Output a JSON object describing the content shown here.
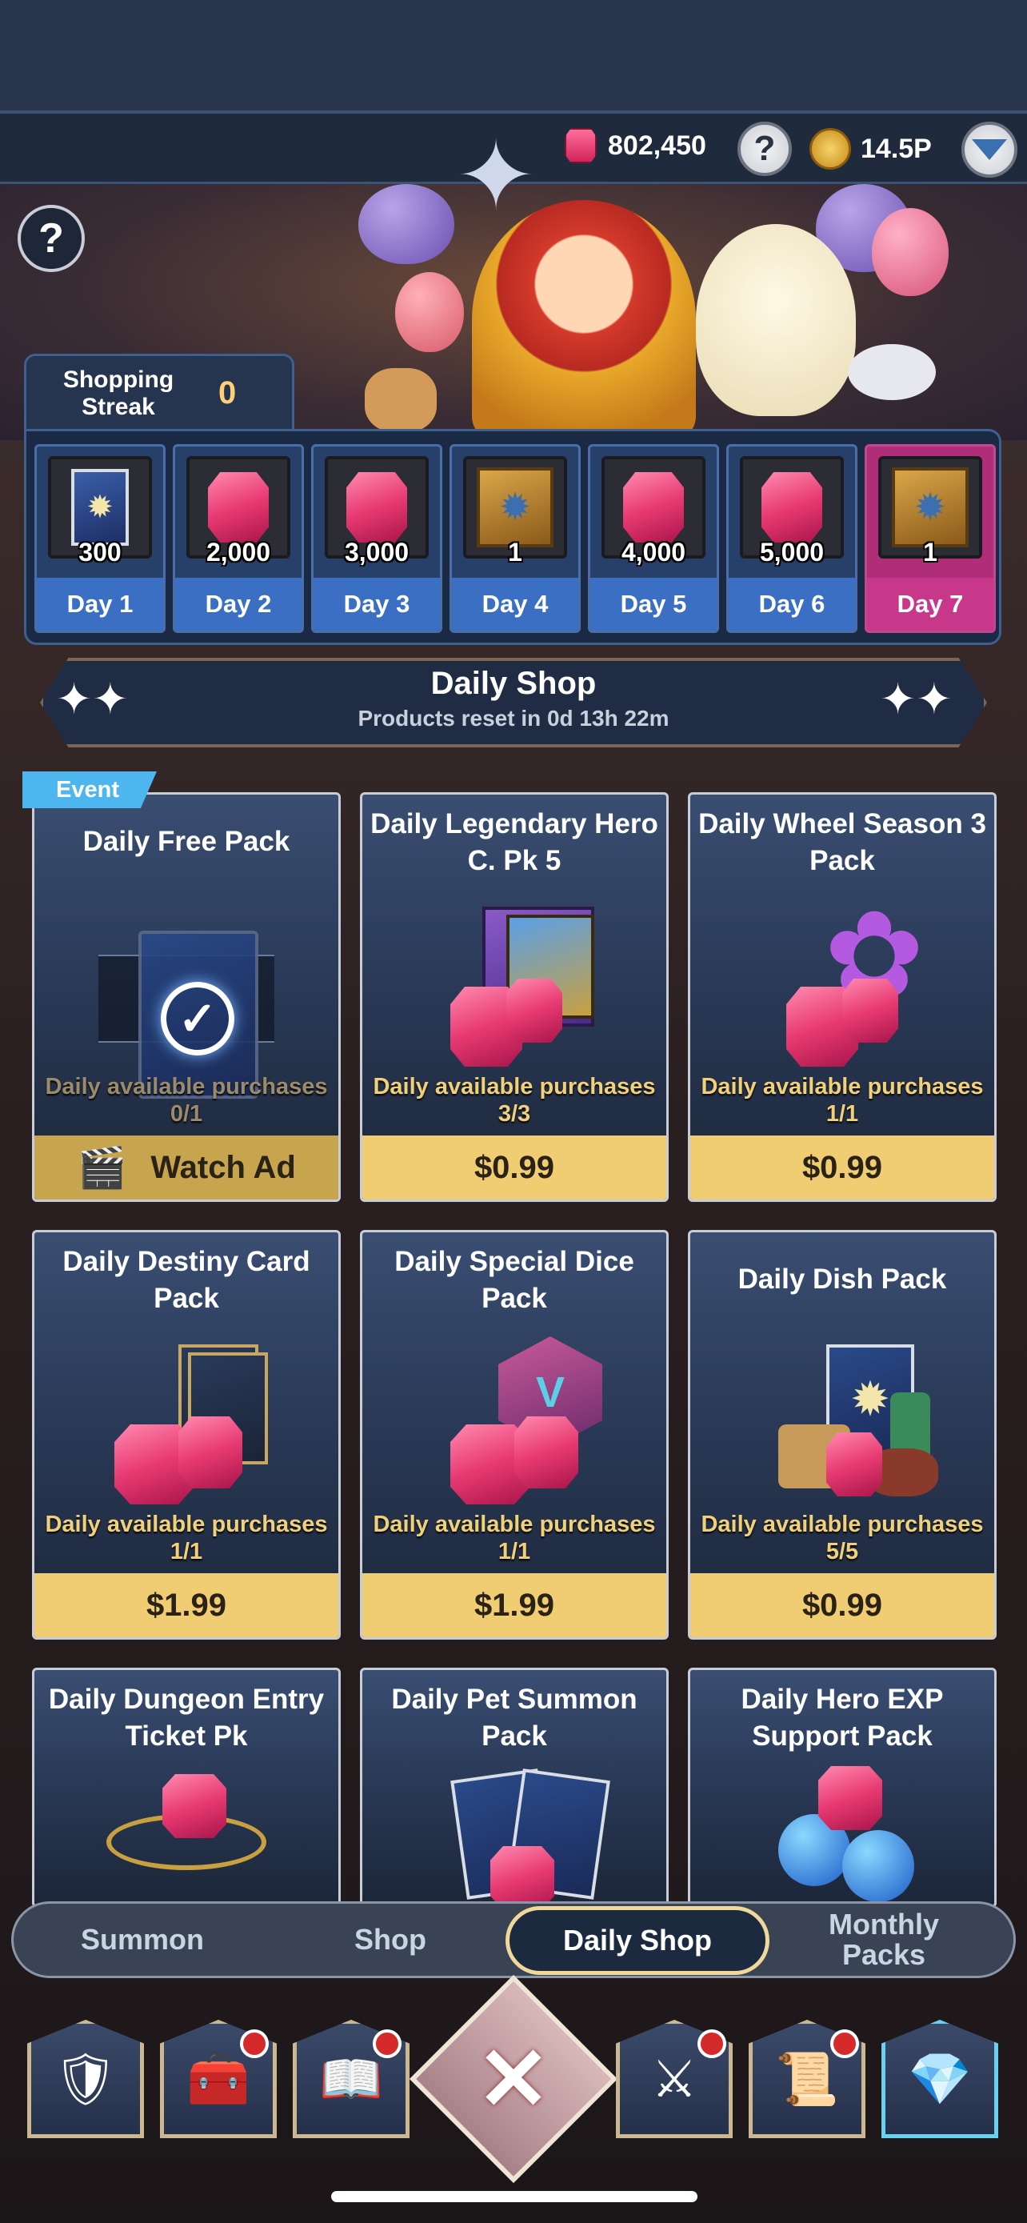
{
  "resources": {
    "gems": "802,450",
    "gold": "14.5P",
    "icons": [
      "gem-icon",
      "help-icon",
      "gold-coin-icon",
      "dropdown-icon"
    ]
  },
  "streak": {
    "label": "Shopping Streak",
    "count": "0",
    "days": [
      {
        "label": "Day 1",
        "qty": "300",
        "reward": "summon-card-icon"
      },
      {
        "label": "Day 2",
        "qty": "2,000",
        "reward": "gem-icon"
      },
      {
        "label": "Day 3",
        "qty": "3,000",
        "reward": "gem-icon"
      },
      {
        "label": "Day 4",
        "qty": "1",
        "reward": "skill-book-icon"
      },
      {
        "label": "Day 5",
        "qty": "4,000",
        "reward": "gem-icon"
      },
      {
        "label": "Day 6",
        "qty": "5,000",
        "reward": "gem-icon"
      },
      {
        "label": "Day 7",
        "qty": "1",
        "reward": "skill-book-icon"
      }
    ]
  },
  "daily_shop": {
    "title": "Daily Shop",
    "reset": "Products reset in 0d 13h 22m",
    "event_tag": "Event"
  },
  "products": [
    {
      "name": "Daily Free Pack",
      "avail_label": "Daily available purchases",
      "avail": "0/1",
      "price": "Watch Ad"
    },
    {
      "name": "Daily Legendary Hero C. Pk 5",
      "avail_label": "Daily available purchases",
      "avail": "3/3",
      "price": "$0.99"
    },
    {
      "name": "Daily Wheel Season 3 Pack",
      "avail_label": "Daily available purchases",
      "avail": "1/1",
      "price": "$0.99"
    },
    {
      "name": "Daily Destiny Card Pack",
      "avail_label": "Daily available purchases",
      "avail": "1/1",
      "price": "$1.99"
    },
    {
      "name": "Daily Special Dice Pack",
      "avail_label": "Daily available purchases",
      "avail": "1/1",
      "price": "$1.99"
    },
    {
      "name": "Daily Dish Pack",
      "avail_label": "Daily available purchases",
      "avail": "5/5",
      "price": "$0.99"
    },
    {
      "name": "Daily Dungeon Entry Ticket Pk",
      "avail_label": "",
      "avail": "",
      "price": ""
    },
    {
      "name": "Daily Pet Summon Pack",
      "avail_label": "",
      "avail": "",
      "price": ""
    },
    {
      "name": "Daily Hero EXP Support Pack",
      "avail_label": "",
      "avail": "",
      "price": ""
    }
  ],
  "tabs": [
    "Summon",
    "Shop",
    "Daily Shop",
    "Monthly Packs"
  ],
  "active_tab": "Daily Shop",
  "bottom_nav": [
    "hero-icon",
    "guild-icon",
    "quest-book-icon",
    "close-icon",
    "battle-icon",
    "mail-icon",
    "shop-chest-icon"
  ],
  "colors": {
    "price_bar": "#f0cd73",
    "day_label": "#3a6fc4",
    "day7_label": "#c8388a",
    "event_tag": "#4eb6ee"
  }
}
